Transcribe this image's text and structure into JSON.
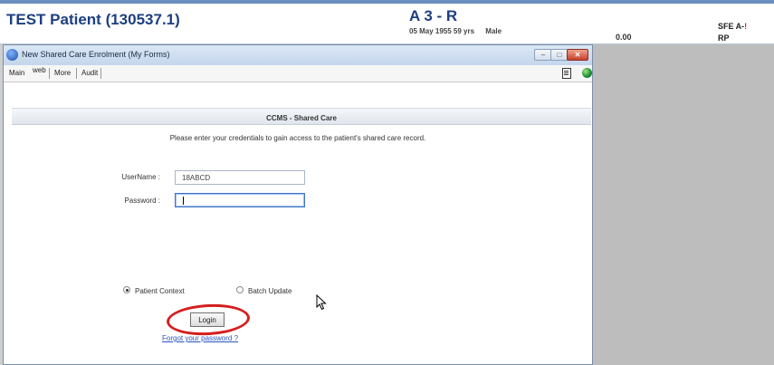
{
  "banner": {
    "patient_name": "TEST Patient (130537.1)",
    "location": "A 3 - R",
    "dob": "05 May 1955 59 yrs",
    "gender": "Male",
    "amount": "0.00",
    "sfe": "SFE A-",
    "sfe_alert": "!",
    "rp": "RP"
  },
  "window": {
    "title": "New Shared Care Enrolment (My Forms)",
    "controls": {
      "minimize": "–",
      "maximize": "□",
      "close": "✕"
    }
  },
  "tabs": [
    {
      "label": "Main"
    },
    {
      "label": "web"
    },
    {
      "label": "More"
    },
    {
      "label": "Audit"
    }
  ],
  "form": {
    "section_title": "CCMS - Shared Care",
    "instructions": "Please enter your credentials to gain access to the patient's shared care record.",
    "username_label": "UserName :",
    "username_value": "18ABCD",
    "password_label": "Password :",
    "password_value": "",
    "radio_options": [
      {
        "label": "Patient Context",
        "selected": true
      },
      {
        "label": "Batch Update",
        "selected": false
      }
    ],
    "login_label": "Login",
    "forgot_link": "Forgot your password ?"
  },
  "colors": {
    "banner_text": "#1d3f80",
    "highlight_ring": "#d41f1f",
    "link": "#2a55c0"
  },
  "icons": [
    "globe-icon",
    "document-icon",
    "browser-icon",
    "cursor-icon"
  ]
}
